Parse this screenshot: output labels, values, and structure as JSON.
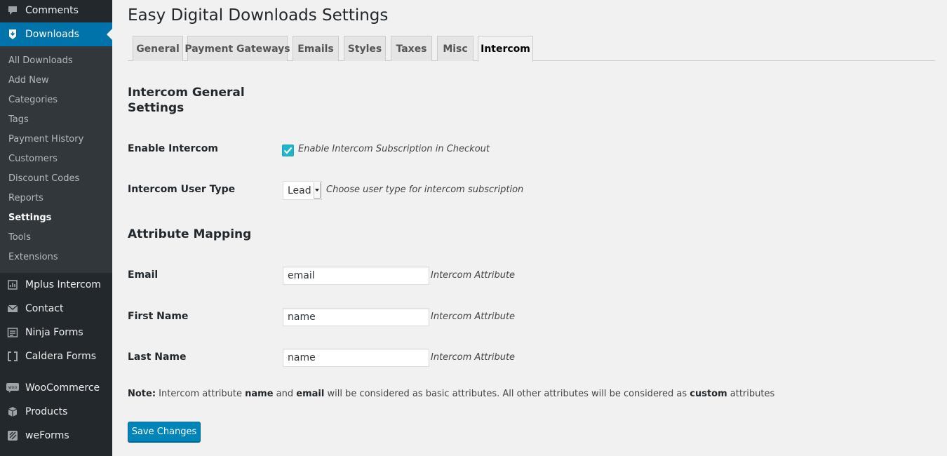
{
  "sidebar": {
    "top_items": [
      {
        "label": "Comments",
        "icon": "comment-icon"
      },
      {
        "label": "Downloads",
        "icon": "download-icon",
        "current": true
      },
      {
        "label": "Mplus Intercom",
        "icon": "chart-icon"
      },
      {
        "label": "Contact",
        "icon": "mail-icon"
      },
      {
        "label": "Ninja Forms",
        "icon": "forms-icon"
      },
      {
        "label": "Caldera Forms",
        "icon": "bracket-icon"
      },
      {
        "label": "WooCommerce",
        "icon": "woo-icon"
      },
      {
        "label": "Products",
        "icon": "box-icon"
      },
      {
        "label": "weForms",
        "icon": "weforms-icon"
      }
    ],
    "submenu": [
      {
        "label": "All Downloads"
      },
      {
        "label": "Add New"
      },
      {
        "label": "Categories"
      },
      {
        "label": "Tags"
      },
      {
        "label": "Payment History"
      },
      {
        "label": "Customers"
      },
      {
        "label": "Discount Codes"
      },
      {
        "label": "Reports"
      },
      {
        "label": "Settings",
        "active": true
      },
      {
        "label": "Tools"
      },
      {
        "label": "Extensions"
      }
    ]
  },
  "page": {
    "title": "Easy Digital Downloads Settings"
  },
  "tabs": [
    {
      "label": "General"
    },
    {
      "label": "Payment Gateways"
    },
    {
      "label": "Emails"
    },
    {
      "label": "Styles"
    },
    {
      "label": "Taxes"
    },
    {
      "label": "Misc"
    },
    {
      "label": "Intercom",
      "active": true
    }
  ],
  "general_settings": {
    "heading_line1": "Intercom General",
    "heading_line2": "Settings",
    "enable_label": "Enable Intercom",
    "enable_checked": true,
    "enable_description": "Enable Intercom Subscription in Checkout",
    "user_type_label": "Intercom User Type",
    "user_type_value": "Lead",
    "user_type_description": "Choose user type for intercom subscription"
  },
  "attribute_mapping": {
    "heading": "Attribute Mapping",
    "fields": [
      {
        "label": "Email",
        "value": "email",
        "description": "Intercom Attribute"
      },
      {
        "label": "First Name",
        "value": "name",
        "description": "Intercom Attribute"
      },
      {
        "label": "Last Name",
        "value": "name",
        "description": "Intercom Attribute"
      }
    ]
  },
  "note": {
    "prefix": "Note:",
    "part1": " Intercom attribute ",
    "bold1": "name",
    "part2": " and ",
    "bold2": "email",
    "part3": " will be considered as basic attributes. All other attributes will be considered as ",
    "bold3": "custom",
    "part4": " attributes"
  },
  "save_label": "Save Changes",
  "colors": {
    "sidebar_bg": "#23282d",
    "submenu_bg": "#32373c",
    "current_menu": "#0073aa",
    "checkbox": "#1fb6c9",
    "primary_button": "#0085ba"
  }
}
